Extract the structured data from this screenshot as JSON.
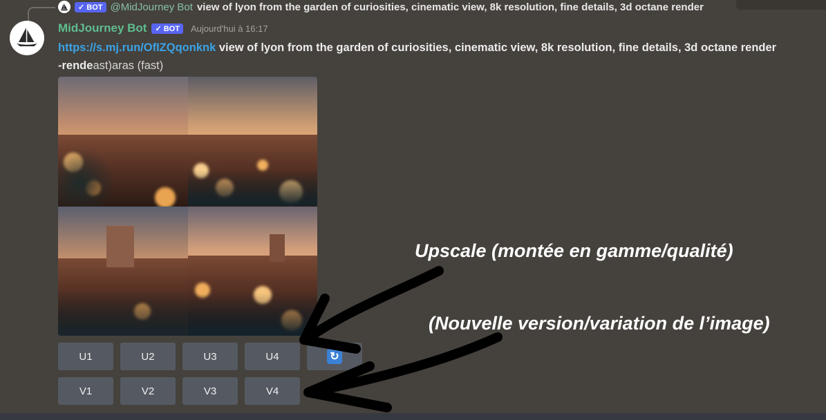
{
  "reply": {
    "badge": "✓ BOT",
    "mention": "@MidJourney Bot",
    "text": "view of lyon from the garden of curiosities, cinematic view, 8k resolution, fine details, 3d octane render"
  },
  "message": {
    "author": "MidJourney Bot",
    "badge": "✓ BOT",
    "timestamp": "Aujourd'hui à 16:17",
    "link": "https://s.mj.run/OfIZQqonknk",
    "prompt": " view of lyon from the garden of curiosities, cinematic view, 8k resolution, fine details, 3d octane render",
    "suffix_bold": " -rende",
    "suffix_light": "ast)aras (fast)"
  },
  "buttons": {
    "upscale": [
      "U1",
      "U2",
      "U3",
      "U4"
    ],
    "variation": [
      "V1",
      "V2",
      "V3",
      "V4"
    ],
    "refresh_icon": "refresh-icon"
  },
  "annotations": {
    "upscale": "Upscale (montée en gamme/qualité)",
    "variation": "(Nouvelle version/variation de l’image)"
  },
  "colors": {
    "background": "#45413c",
    "author": "#5fbd8e",
    "link": "#3aa3e6",
    "badge": "#5865f2",
    "button": "#555a62"
  }
}
